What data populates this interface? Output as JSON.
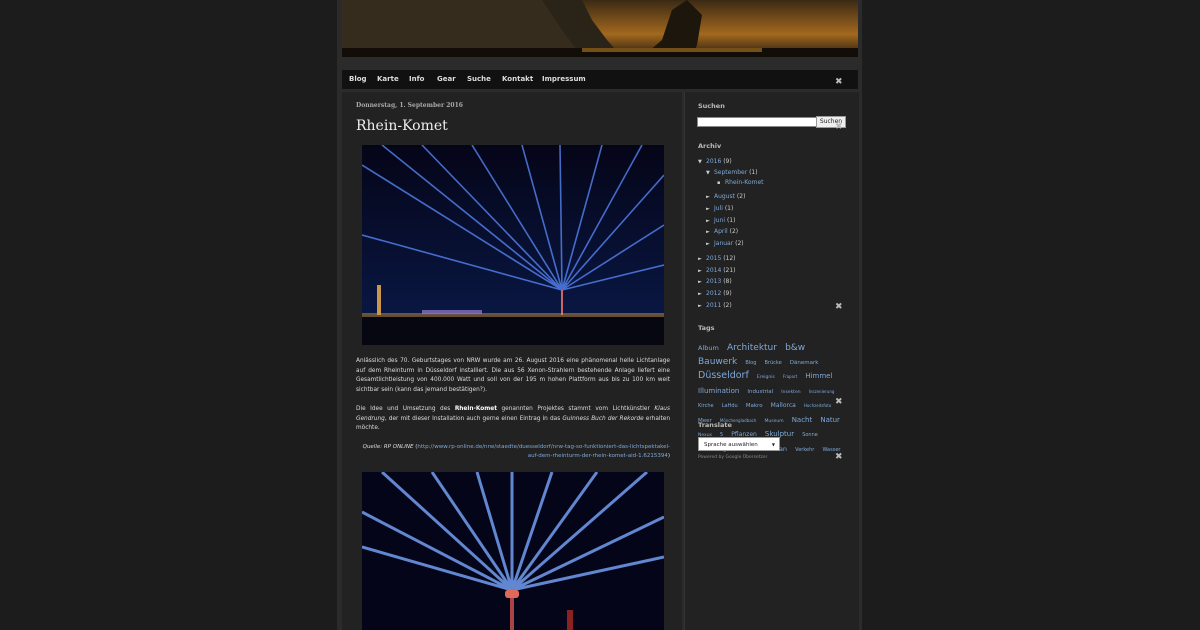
{
  "nav": [
    "Blog",
    "Karte",
    "Info",
    "Gear",
    "Suche",
    "Kontakt",
    "Impressum"
  ],
  "post": {
    "date": "Donnerstag, 1. September 2016",
    "title": "Rhein-Komet",
    "p1": "Anlässlich des 70. Geburtstages von NRW wurde am 26. August 2016 eine phänomenal helle Lichtanlage auf dem Rheinturm in Düsseldorf installiert. Die aus 56 Xenon-Strahlern bestehende Anlage liefert eine Gesamtlichtleistung von 400.000 Watt und soll von der 195 m hohen Plattform aus bis zu 100 km weit sichtbar sein (kann das jemand bestätigen?).",
    "p2_pre": "Die Idee und Umsetzung des ",
    "p2_bold": "Rhein-Komet",
    "p2_mid": " genannten Projektes stammt vom Lichtkünstler ",
    "p2_artist": "Klaus Gendrung",
    "p2_mid2": ", der mit dieser Installation auch gerne einen Eintrag in das ",
    "p2_book": "Guinness Buch der Rekorde",
    "p2_end": " erhalten möchte.",
    "quote_label": "Quelle: RP ONLINE",
    "quote_link": "http://www.rp-online.de/nrw/staedte/duesseldorf/nrw-tag-so-funktioniert-das-lichtspektakel-auf-dem-rheinturm-der-rhein-komet-aid-1.6215394"
  },
  "sidebar": {
    "search_title": "Suchen",
    "search_button": "Suchen",
    "archive_title": "Archiv",
    "archive": [
      {
        "tri": "▼",
        "label": "2016",
        "count": "(9)",
        "level": 0
      },
      {
        "tri": "▼",
        "label": "September",
        "count": "(1)",
        "level": 1
      },
      {
        "tri": "▪",
        "label": "Rhein-Komet",
        "count": "",
        "level": 2
      },
      {
        "tri": "►",
        "label": "August",
        "count": "(2)",
        "level": 1
      },
      {
        "tri": "►",
        "label": "Juli",
        "count": "(1)",
        "level": 1
      },
      {
        "tri": "►",
        "label": "Juni",
        "count": "(1)",
        "level": 1
      },
      {
        "tri": "►",
        "label": "April",
        "count": "(2)",
        "level": 1
      },
      {
        "tri": "►",
        "label": "Januar",
        "count": "(2)",
        "level": 1
      },
      {
        "tri": "►",
        "label": "2015",
        "count": "(12)",
        "level": 0
      },
      {
        "tri": "►",
        "label": "2014",
        "count": "(21)",
        "level": 0
      },
      {
        "tri": "►",
        "label": "2013",
        "count": "(8)",
        "level": 0
      },
      {
        "tri": "►",
        "label": "2012",
        "count": "(9)",
        "level": 0
      },
      {
        "tri": "►",
        "label": "2011",
        "count": "(2)",
        "level": 0
      }
    ],
    "tags_title": "Tags",
    "tags": [
      {
        "t": "Album",
        "s": 6.5
      },
      {
        "t": "Architektur",
        "s": 9
      },
      {
        "t": "b&w",
        "s": 9
      },
      {
        "t": "Bauwerk",
        "s": 9
      },
      {
        "t": "Blog",
        "s": 5
      },
      {
        "t": "Brücke",
        "s": 5
      },
      {
        "t": "Dänemark",
        "s": 5.5
      },
      {
        "t": "Düsseldorf",
        "s": 9.5
      },
      {
        "t": "Ereignis",
        "s": 4.5
      },
      {
        "t": "Fraport",
        "s": 4
      },
      {
        "t": "Himmel",
        "s": 7
      },
      {
        "t": "Illumination",
        "s": 7
      },
      {
        "t": "Industrial",
        "s": 5.5
      },
      {
        "t": "Insekten",
        "s": 4.5
      },
      {
        "t": "Inszenierung",
        "s": 4
      },
      {
        "t": "Kirche",
        "s": 5
      },
      {
        "t": "LaHdu",
        "s": 5
      },
      {
        "t": "Makro",
        "s": 5.5
      },
      {
        "t": "Mallorca",
        "s": 6
      },
      {
        "t": "Hochzeitsfoto",
        "s": 4
      },
      {
        "t": "Meer",
        "s": 5.5
      },
      {
        "t": "Mönchengladbach",
        "s": 4
      },
      {
        "t": "Museum",
        "s": 4.5
      },
      {
        "t": "Nacht",
        "s": 7
      },
      {
        "t": "Natur",
        "s": 7
      },
      {
        "t": "Nexus",
        "s": 4.5
      },
      {
        "t": "5",
        "s": 5
      },
      {
        "t": "Pflanzen",
        "s": 6
      },
      {
        "t": "Skulptur",
        "s": 7
      },
      {
        "t": "Sonne",
        "s": 5
      },
      {
        "t": "Streetfotografie",
        "s": 5
      },
      {
        "t": "Tiere",
        "s": 5.5
      },
      {
        "t": "Urban",
        "s": 6.5
      },
      {
        "t": "Verkehr",
        "s": 5
      },
      {
        "t": "Wasser",
        "s": 5
      }
    ],
    "translate_title": "Translate",
    "translate_select": "Sprache auswählen",
    "powered_by": "Powered by Google Übersetzer"
  }
}
